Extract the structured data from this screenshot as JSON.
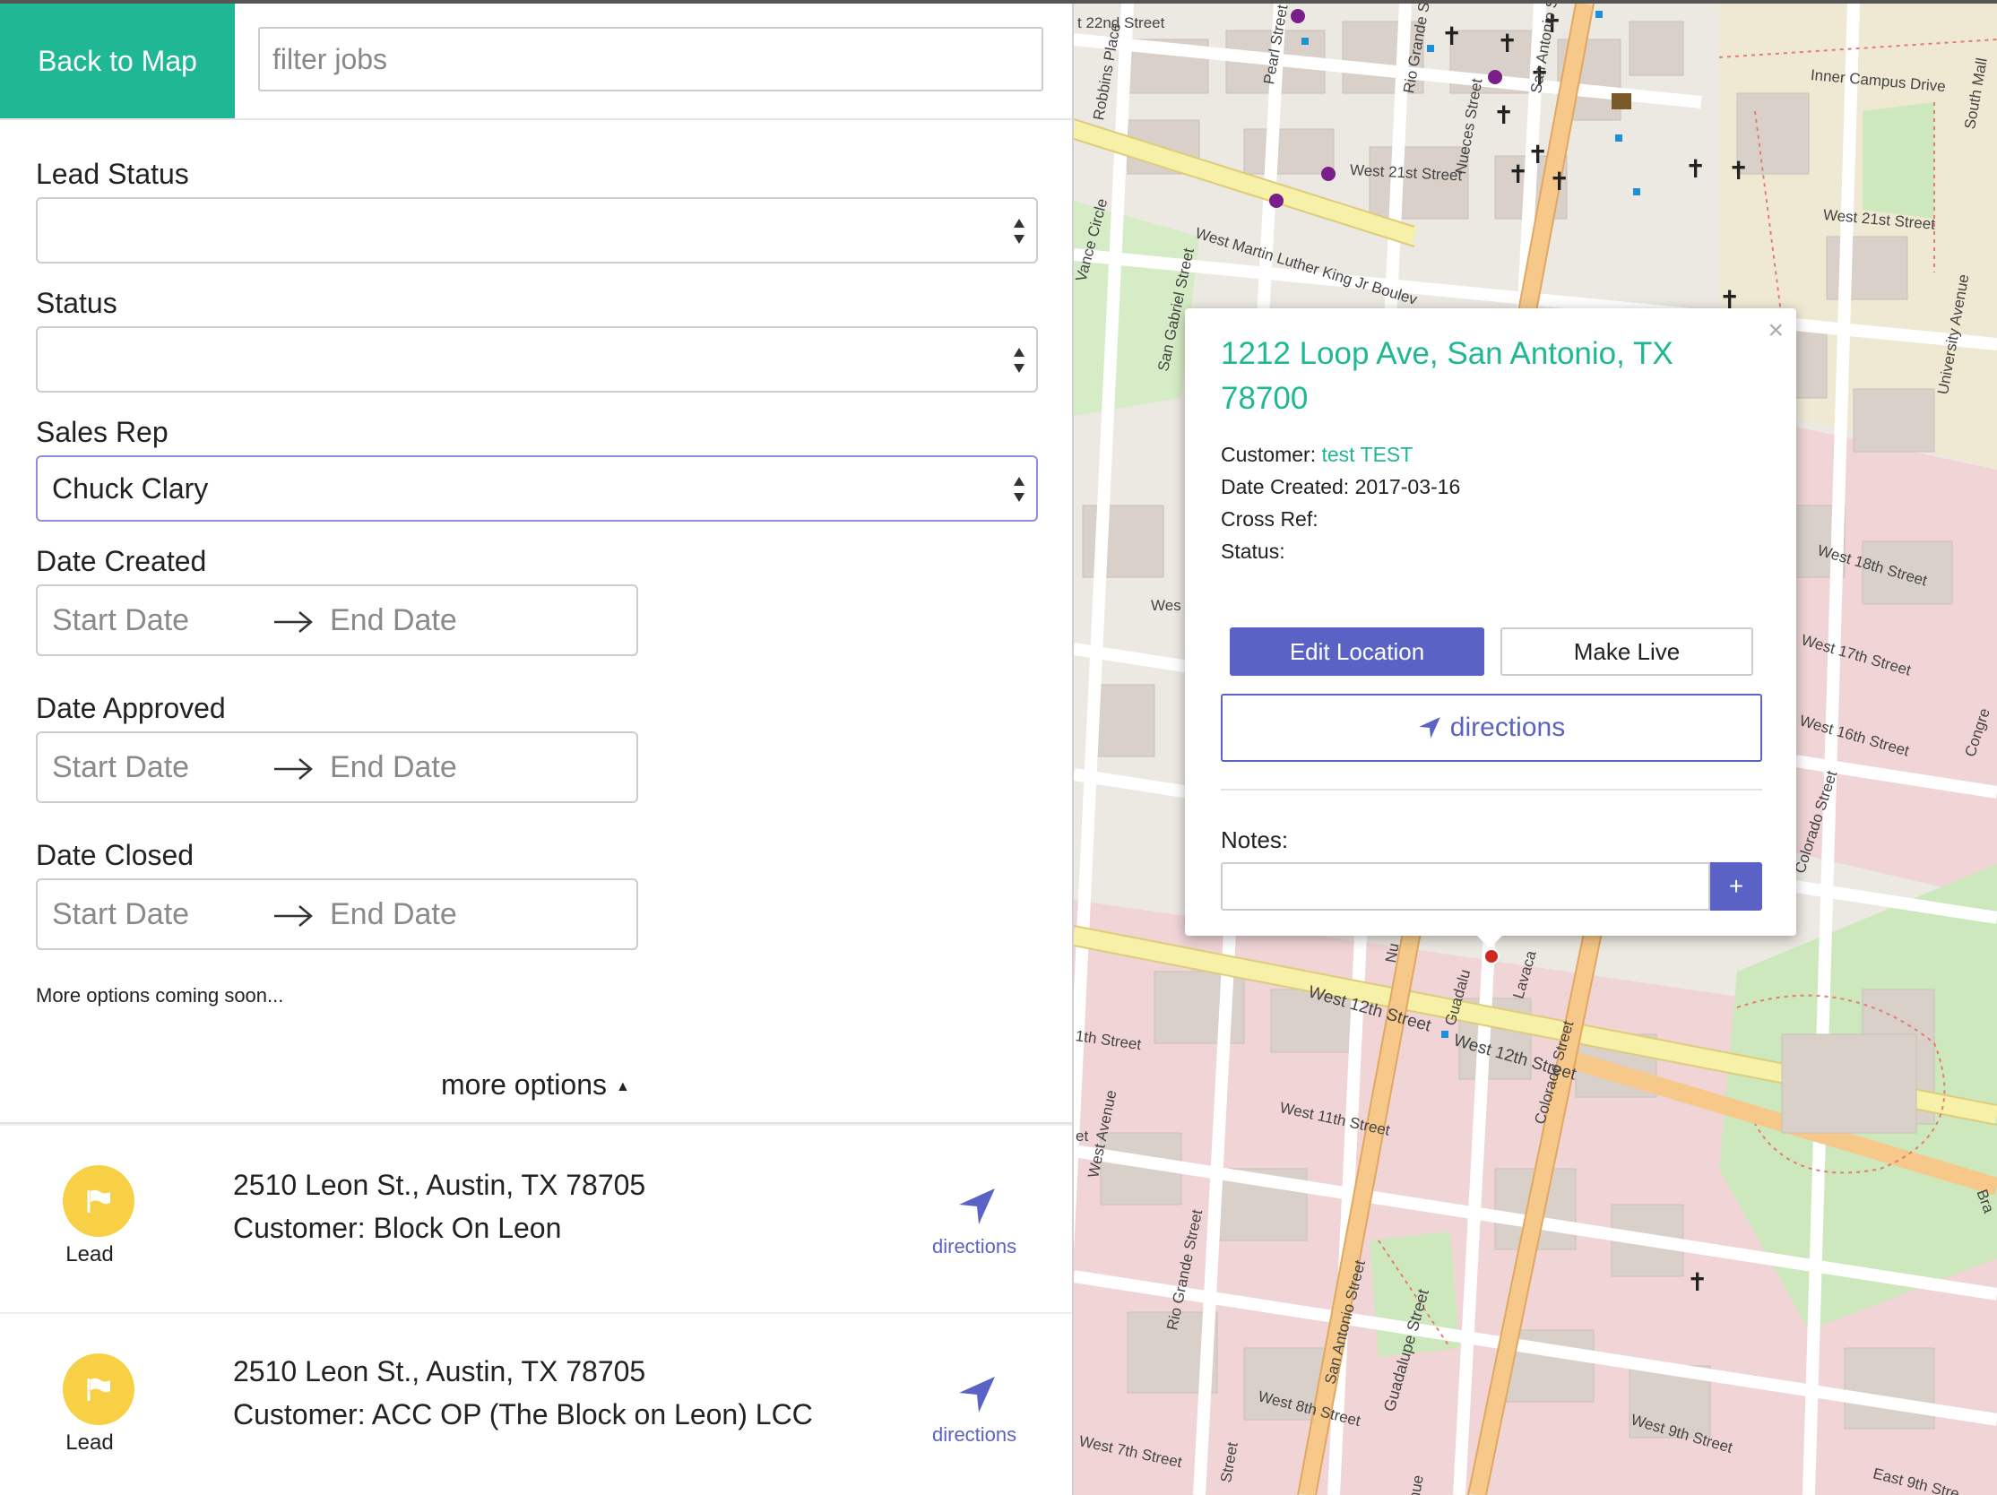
{
  "sidebar": {
    "back_button": "Back to Map",
    "filter_placeholder": "filter jobs",
    "filters": {
      "lead_status_label": "Lead Status",
      "lead_status_value": "",
      "status_label": "Status",
      "status_value": "",
      "sales_rep_label": "Sales Rep",
      "sales_rep_value": "Chuck Clary",
      "date_created_label": "Date Created",
      "date_approved_label": "Date Approved",
      "date_closed_label": "Date Closed",
      "start_placeholder": "Start Date",
      "end_placeholder": "End Date"
    },
    "soon_text": "More options coming soon...",
    "more_options": "more options",
    "more_options_arrow": "▲"
  },
  "jobs": [
    {
      "badge": "Lead",
      "address": "2510 Leon St., Austin, TX 78705",
      "customer": "Customer: Block On Leon",
      "directions": "directions",
      "badge_icon": "flag-icon"
    },
    {
      "badge": "Lead",
      "address": "2510 Leon St., Austin, TX 78705",
      "customer": "Customer: ACC OP (The Block on Leon) LCC",
      "directions": "directions",
      "badge_icon": "flag-icon"
    }
  ],
  "popup": {
    "title": "1212 Loop Ave, San Antonio, TX 78700",
    "customer_label": "Customer:",
    "customer_value": "test TEST",
    "date_created": "Date Created: 2017-03-16",
    "cross_ref": "Cross Ref:",
    "status": "Status:",
    "edit_button": "Edit Location",
    "live_button": "Make Live",
    "directions_button": "directions",
    "notes_label": "Notes:",
    "notes_value": "",
    "add_button": "+",
    "close": "×"
  },
  "map": {
    "streets": [
      "t 22nd Street",
      "Robbins Place",
      "Pearl Street",
      "Rio Grande Stre",
      "Nueces Street",
      "San Antonio St",
      "Inner Campus Drive",
      "South Mall",
      "West 21st Street",
      "West 21st Street",
      "West Martin Luther King Jr Boulev",
      "Vance Circle",
      "San Gabriel Street",
      "University Avenue",
      "West 18th Street",
      "West 17th Street",
      "West 16th Street",
      "Colorado Street",
      "Congre",
      "Wes",
      "West 12th Street",
      "West 12th Street",
      "1th Street",
      "West 11th Street",
      "West Avenue",
      "Rio Grande Street",
      "San Antonio Street",
      "Guadalupe Street",
      "Guadalu",
      "Lavaca",
      "Colorado Street",
      "West 8th Street",
      "West 7th Street",
      "West 9th Street",
      "East 9th Stre",
      "Street",
      "Nu",
      "et",
      "Bra",
      "Street",
      "nue"
    ],
    "colors": {
      "accent": "#20b894",
      "primary": "#5a63c5",
      "lead_badge": "#f7d046",
      "pin": "#d0281e"
    }
  }
}
